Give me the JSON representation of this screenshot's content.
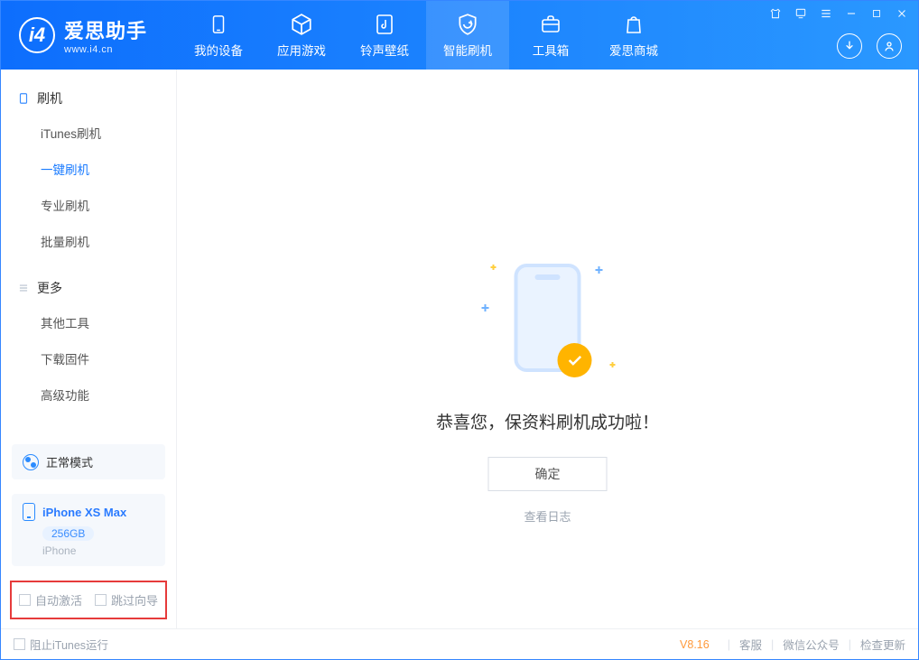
{
  "app": {
    "name": "爱思助手",
    "url": "www.i4.cn"
  },
  "nav": {
    "items": [
      {
        "label": "我的设备"
      },
      {
        "label": "应用游戏"
      },
      {
        "label": "铃声壁纸"
      },
      {
        "label": "智能刷机"
      },
      {
        "label": "工具箱"
      },
      {
        "label": "爱思商城"
      }
    ]
  },
  "sidebar": {
    "group1": {
      "title": "刷机",
      "items": [
        "iTunes刷机",
        "一键刷机",
        "专业刷机",
        "批量刷机"
      ]
    },
    "group2": {
      "title": "更多",
      "items": [
        "其他工具",
        "下载固件",
        "高级功能"
      ]
    },
    "mode": "正常模式",
    "device": {
      "name": "iPhone XS Max",
      "storage": "256GB",
      "type": "iPhone"
    },
    "checks": {
      "auto_activate": "自动激活",
      "skip_guide": "跳过向导"
    }
  },
  "main": {
    "message": "恭喜您，保资料刷机成功啦！",
    "ok": "确定",
    "view_log": "查看日志"
  },
  "footer": {
    "block_itunes": "阻止iTunes运行",
    "version": "V8.16",
    "links": [
      "客服",
      "微信公众号",
      "检查更新"
    ]
  }
}
